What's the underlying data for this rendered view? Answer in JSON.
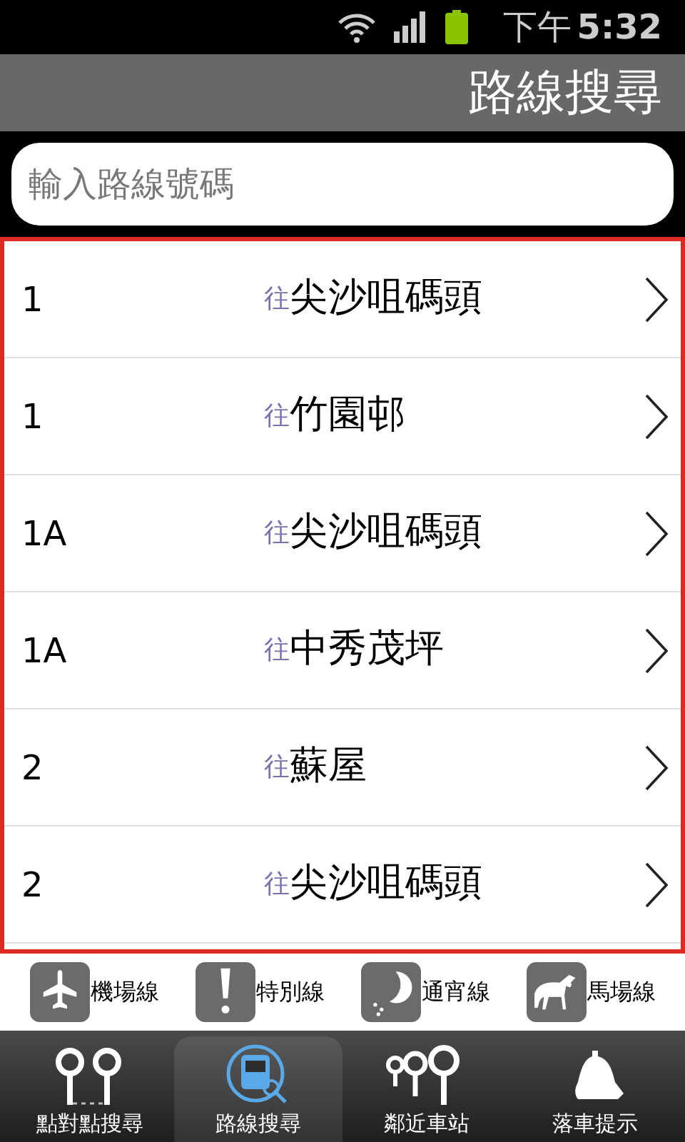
{
  "status_bar": {
    "time_period": "下午",
    "time": "5:32"
  },
  "title": "路線搜尋",
  "search": {
    "placeholder": "輸入路線號碼"
  },
  "routes": [
    {
      "number": "1",
      "prefix": "往",
      "destination": "尖沙咀碼頭"
    },
    {
      "number": "1",
      "prefix": "往",
      "destination": "竹園邨"
    },
    {
      "number": "1A",
      "prefix": "往",
      "destination": "尖沙咀碼頭"
    },
    {
      "number": "1A",
      "prefix": "往",
      "destination": "中秀茂坪"
    },
    {
      "number": "2",
      "prefix": "往",
      "destination": "蘇屋"
    },
    {
      "number": "2",
      "prefix": "往",
      "destination": "尖沙咀碼頭"
    }
  ],
  "categories": [
    {
      "kind": "airport",
      "label": "機場線"
    },
    {
      "kind": "special",
      "label": "特別線"
    },
    {
      "kind": "overnight",
      "label": "通宵線"
    },
    {
      "kind": "racecourse",
      "label": "馬場線"
    }
  ],
  "nav": [
    {
      "kind": "point_to_point",
      "label": "點對點搜尋",
      "selected": false
    },
    {
      "kind": "route_search",
      "label": "路線搜尋",
      "selected": true
    },
    {
      "kind": "nearby",
      "label": "鄰近車站",
      "selected": false
    },
    {
      "kind": "alert",
      "label": "落車提示",
      "selected": false
    }
  ]
}
